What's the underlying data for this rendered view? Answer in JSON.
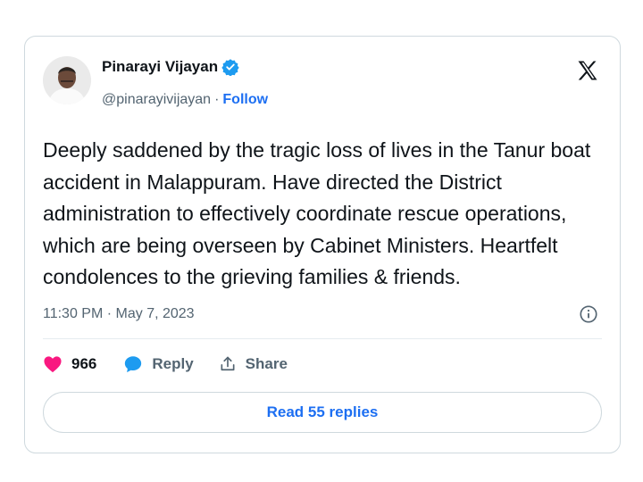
{
  "author": {
    "name": "Pinarayi Vijayan",
    "handle": "@pinarayivijayan",
    "separator": "·",
    "follow_label": "Follow",
    "avatar_icon": "avatar-portrait",
    "verified_icon": "verified-badge-icon"
  },
  "tweet": {
    "text": "Deeply saddened by the tragic loss of lives in the Tanur boat accident in Malappuram. Have directed the District administration to effectively coordinate rescue operations, which are being overseen by Cabinet Ministers. Heartfelt condolences to the grieving families & friends.",
    "timestamp": "11:30 PM · May 7, 2023"
  },
  "actions": {
    "likes_count": "966",
    "reply_label": "Reply",
    "share_label": "Share"
  },
  "read_replies_label": "Read 55 replies",
  "colors": {
    "accent": "#1d6ff2",
    "like": "#f91880",
    "reply_icon": "#1d9bf0",
    "muted": "#536471",
    "border": "#cfd9de"
  }
}
